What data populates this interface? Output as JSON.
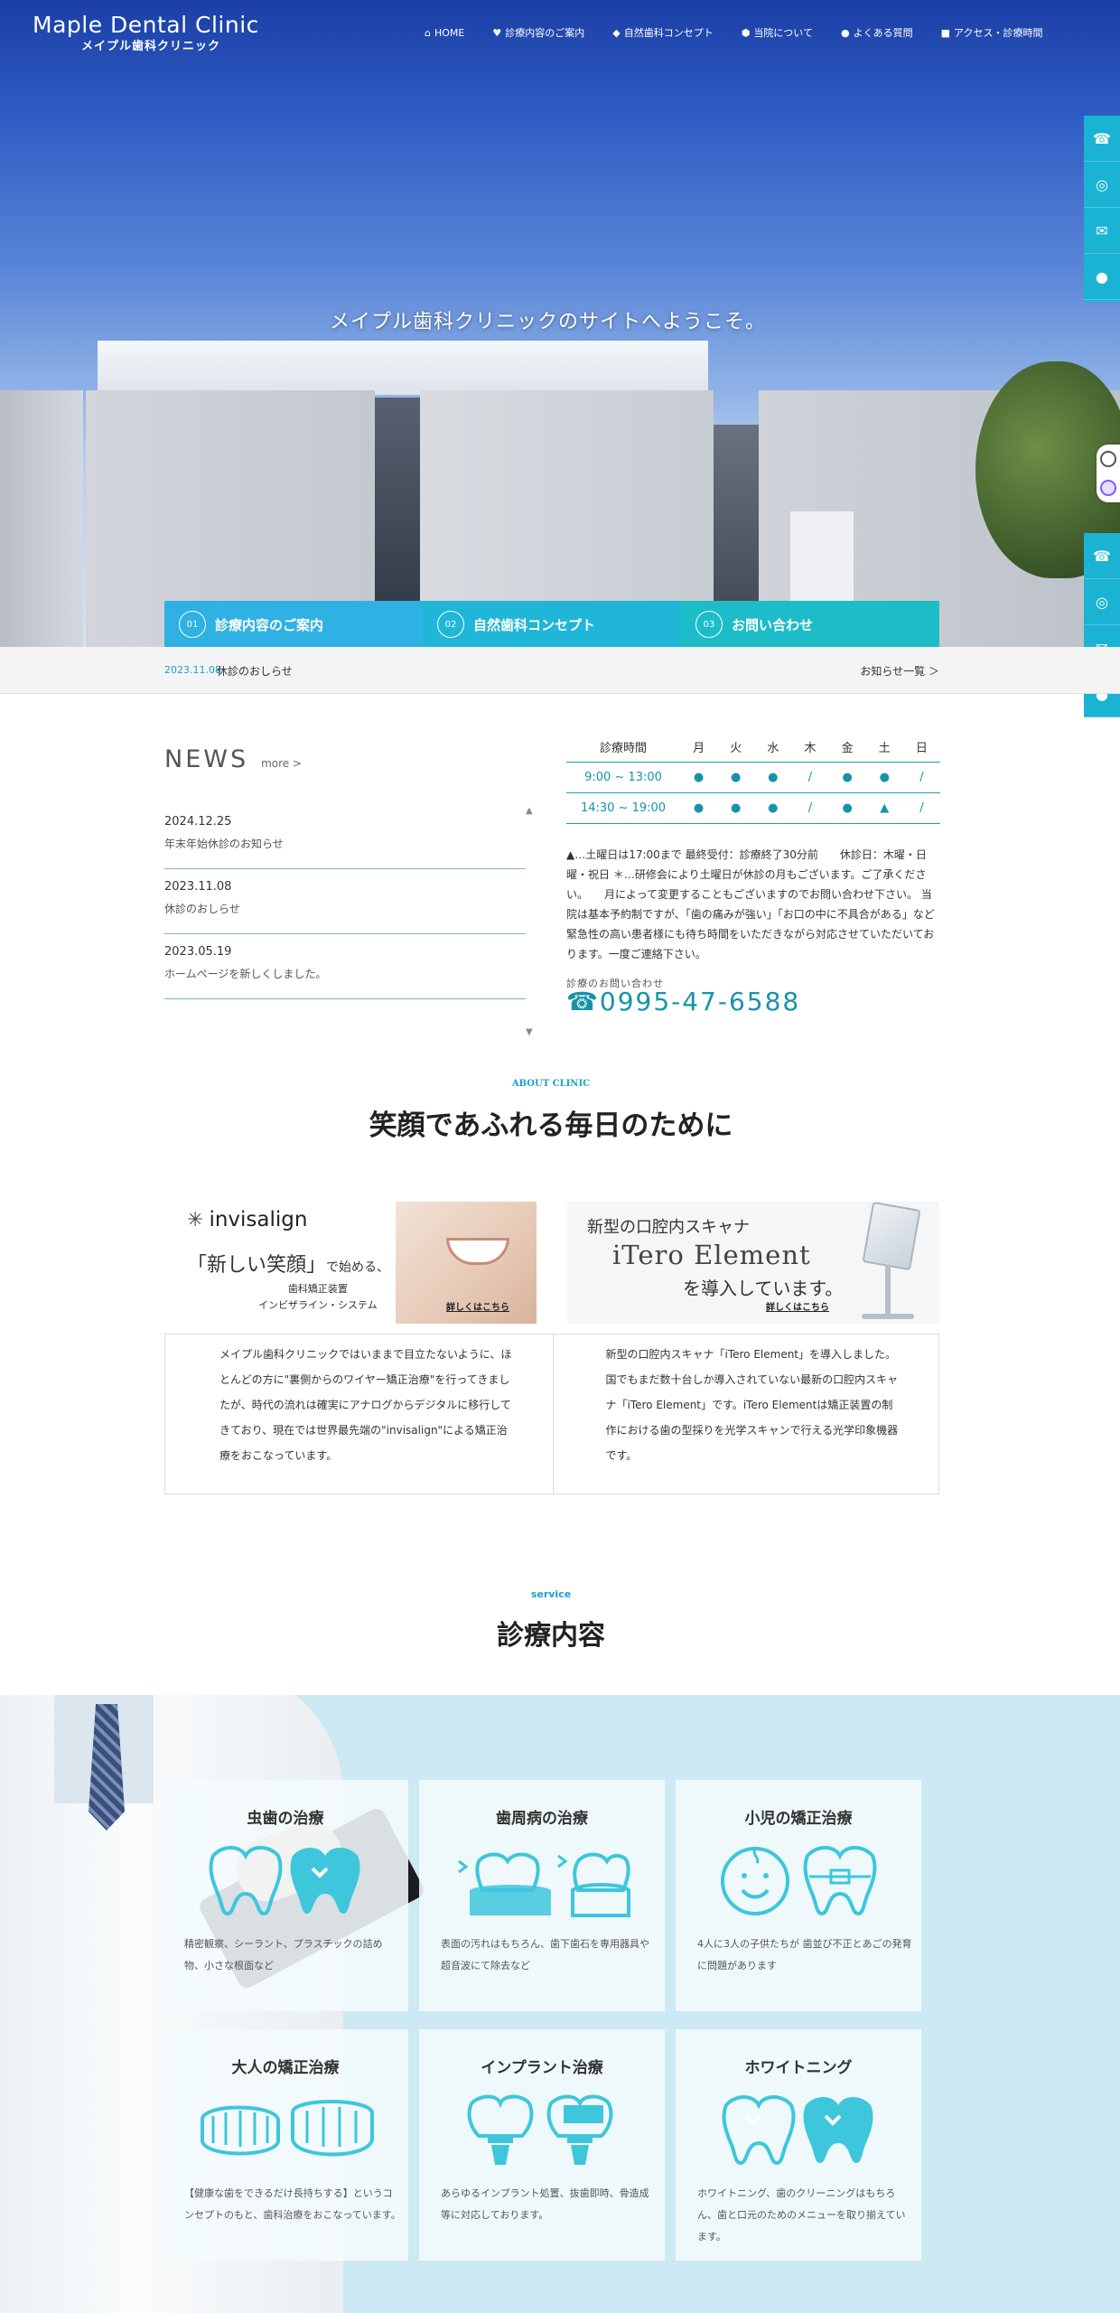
{
  "header": {
    "logo_main": "Maple Dental Clinic",
    "logo_sub": "メイプル歯科クリニック",
    "nav": [
      {
        "label": "HOME",
        "icon": "home-icon"
      },
      {
        "label": "診療内容のご案内",
        "icon": "tooth-care-icon"
      },
      {
        "label": "自然歯科コンセプト",
        "icon": "tooth-icon"
      },
      {
        "label": "当院について",
        "icon": "house-icon"
      },
      {
        "label": "よくある質問",
        "icon": "chat-icon"
      },
      {
        "label": "アクセス・診療時間",
        "icon": "car-icon"
      }
    ]
  },
  "hero": {
    "title": "メイプル歯科クリニックのサイトへようこそ。",
    "cta": [
      {
        "num": "01",
        "label": "診療内容のご案内"
      },
      {
        "num": "02",
        "label": "自然歯科コンセプト"
      },
      {
        "num": "03",
        "label": "お問い合わせ"
      }
    ]
  },
  "side_icons": [
    "phone-icon",
    "instagram-icon",
    "mail-icon",
    "location-icon"
  ],
  "ticker": {
    "date": "2023.11.08",
    "text": "休診のおしらせ",
    "more": "お知らせ一覧 ＞"
  },
  "news": {
    "title": "NEWS",
    "more": "more >",
    "items": [
      {
        "date": "2024.12.25",
        "text": "年末年始休診のお知らせ"
      },
      {
        "date": "2023.11.08",
        "text": "休診のおしらせ"
      },
      {
        "date": "2023.05.19",
        "text": "ホームページを新しくしました。"
      }
    ]
  },
  "schedule": {
    "header": [
      "診療時間",
      "月",
      "火",
      "水",
      "木",
      "金",
      "土",
      "日"
    ],
    "rows": [
      [
        "9:00 ~ 13:00",
        "●",
        "●",
        "●",
        "/",
        "●",
        "●",
        "/"
      ],
      [
        "14:30 ~ 19:00",
        "●",
        "●",
        "●",
        "/",
        "●",
        "▲",
        "/"
      ]
    ],
    "note": "▲…土曜日は17:00まで 最終受付：診療終了30分前　　休診日：木曜・日曜・祝日 ＊…研修会により土曜日が休診の月もございます。ご了承ください。　　月によって変更することもございますのでお問い合わせ下さい。 当院は基本予約制ですが、「歯の痛みが強い」「お口の中に不具合がある」など緊急性の高い患者様にも待ち時間をいただきながら対応させていただいております。一度ご連絡下さい。",
    "tel_label": "診療のお問い合わせ",
    "tel": "☎0995-47-6588"
  },
  "about": {
    "en": "ABOUT CLINIC",
    "ja": "笑顔であふれる毎日のために",
    "invisalign": {
      "logo": "invisalign",
      "line1": "「新しい笑顔」",
      "line1_small": "で始める、",
      "line2a": "歯科矯正装置",
      "line2b": "インビザライン・システム",
      "link": "詳しくはこちら",
      "desc": "メイプル歯科クリニックではいままで目立たないように、ほとんどの方に\"裏側からのワイヤー矯正治療\"を行ってきましたが、時代の流れは確実にアナログからデジタルに移行してきており、現在では世界最先端の\"invisalign\"による矯正治療をおこなっています。"
    },
    "itero": {
      "line1": "新型の口腔内スキャナ",
      "line2": "iTero Element",
      "line3": "を導入しています。",
      "link": "詳しくはこちら",
      "desc": "新型の口腔内スキャナ「iTero Element」を導入しました。国でもまだ数十台しか導入されていない最新の口腔内スキャナ「iTero Element」です。iTero Elementは矯正装置の制作における歯の型採りを光学スキャンで行える光学印象機器です。"
    }
  },
  "service": {
    "en": "service",
    "ja": "診療内容",
    "accent": "#3ec6dc",
    "cards": [
      {
        "title": "虫歯の治療",
        "icon": "cavity-teeth-icon",
        "text": "精密観察、シーラント、プラスチックの詰め物、小さな根面など"
      },
      {
        "title": "歯周病の治療",
        "icon": "gum-disease-icon",
        "text": "表面の汚れはもちろん、歯下歯石を専用器具や超音波にて除去など"
      },
      {
        "title": "小児の矯正治療",
        "icon": "child-braces-icon",
        "text": "4人に3人の子供たちが 歯並び不正とあごの発育に問題があります"
      },
      {
        "title": "大人の矯正治療",
        "icon": "aligner-icon",
        "text": "【健康な歯をできるだけ長持ちする】というコンセプトのもと、歯科治療をおこなっています。"
      },
      {
        "title": "インプラント治療",
        "icon": "implant-icon",
        "text": "あらゆるインプラント処置、抜歯即時、骨造成等に対応しております。"
      },
      {
        "title": "ホワイトニング",
        "icon": "whitening-icon",
        "text": "ホワイトニング、歯のクリーニングはもちろん、歯と口元のためのメニューを取り揃えています。"
      }
    ]
  }
}
